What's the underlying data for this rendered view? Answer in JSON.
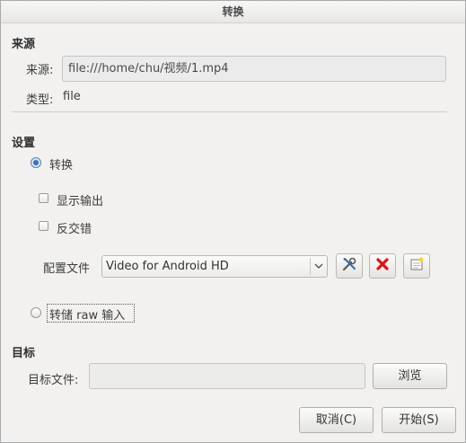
{
  "window": {
    "title": "转换"
  },
  "source": {
    "section_title": "来源",
    "source_label": "来源:",
    "source_value": "file:///home/chu/视频/1.mp4",
    "type_label": "类型:",
    "type_value": "file"
  },
  "settings": {
    "section_title": "设置",
    "convert_label": "转换",
    "convert_selected": true,
    "show_output_label": "显示输出",
    "show_output_checked": false,
    "deinterlace_label": "反交错",
    "deinterlace_checked": false,
    "profile_label": "配置文件",
    "profile_selected": "Video for Android HD",
    "dump_raw_label": "转储 raw 输入",
    "dump_raw_selected": false
  },
  "icons": {
    "edit_profile": "tools-icon",
    "delete_profile": "red-x-icon",
    "new_profile": "new-document-icon",
    "dropdown": "chevron-down-icon"
  },
  "target": {
    "section_title": "目标",
    "file_label": "目标文件:",
    "file_value": "",
    "browse_label": "浏览"
  },
  "actions": {
    "cancel_label": "取消(C)",
    "start_label": "开始(S)"
  },
  "colors": {
    "delete_red": "#d8141b",
    "radio_selected": "#3c6fb4"
  }
}
